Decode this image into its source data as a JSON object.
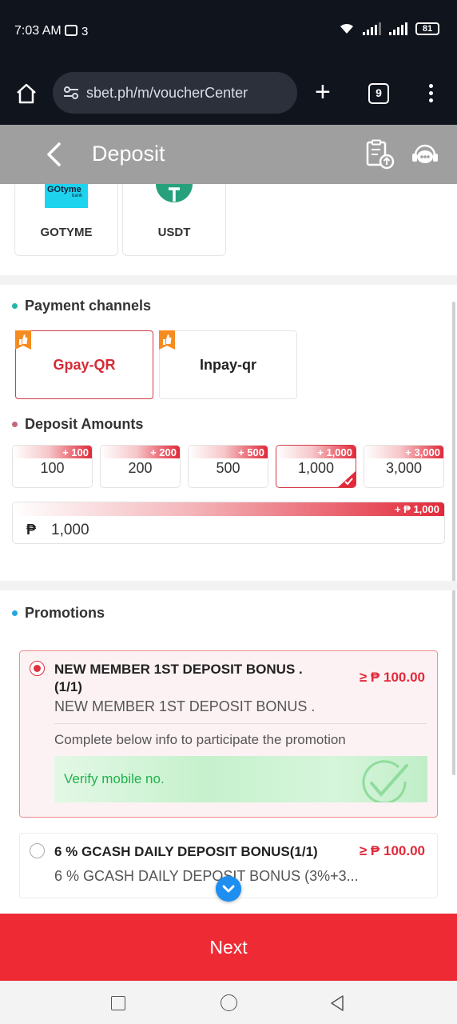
{
  "status_bar": {
    "time": "7:03 AM",
    "notification_count": "3",
    "battery": "81"
  },
  "browser": {
    "url": "sbet.ph/m/voucherCenter",
    "tab_count": "9"
  },
  "header": {
    "title": "Deposit"
  },
  "methods": [
    {
      "label": "GOTYME",
      "logo_text": "GOtyme",
      "logo_sub": "bank"
    },
    {
      "label": "USDT"
    }
  ],
  "payment_channels": {
    "title": "Payment channels",
    "items": [
      {
        "name": "Gpay-QR",
        "selected": true
      },
      {
        "name": "Inpay-qr",
        "selected": false
      }
    ]
  },
  "deposit_amounts": {
    "title": "Deposit Amounts",
    "items": [
      {
        "bonus": "+ 100",
        "value": "100",
        "selected": false
      },
      {
        "bonus": "+ 200",
        "value": "200",
        "selected": false
      },
      {
        "bonus": "+ 500",
        "value": "500",
        "selected": false
      },
      {
        "bonus": "+ 1,000",
        "value": "1,000",
        "selected": true
      },
      {
        "bonus": "+ 3,000",
        "value": "3,000",
        "selected": false
      }
    ],
    "input": {
      "currency": "₱",
      "value": "1,000",
      "bonus": "+ ₱ 1,000"
    }
  },
  "promotions": {
    "title": "Promotions",
    "items": [
      {
        "title_line1": "NEW MEMBER 1ST DEPOSIT BONUS .",
        "title_line2": "(1/1)",
        "amount": "≥ ₱ 100.00",
        "subtitle": "NEW MEMBER 1ST DEPOSIT BONUS .",
        "info": "Complete below info to participate the promotion",
        "verify": "Verify mobile no.",
        "selected": true
      },
      {
        "title_line1": "6 % GCASH DAILY DEPOSIT BONUS(1/1)",
        "amount": "≥ ₱ 100.00",
        "subtitle": "6 % GCASH DAILY DEPOSIT BONUS (3%+3...",
        "selected": false
      }
    ]
  },
  "actions": {
    "next": "Next"
  },
  "colors": {
    "accent": "#ee2b35",
    "header": "#9f9f9f",
    "success": "#22b24c"
  }
}
